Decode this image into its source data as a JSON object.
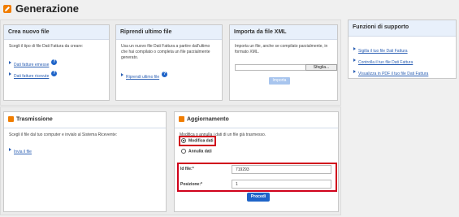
{
  "header": {
    "title": "Generazione"
  },
  "crea": {
    "title": "Crea nuovo file",
    "desc": "Scegli il tipo di file Dati Fattura da creare:",
    "links": [
      "Dati fatture emesse",
      "Dati fatture ricevute"
    ]
  },
  "riprendi": {
    "title": "Riprendi ultimo file",
    "desc": "Usa un nuovo file Dati Fattura a partire dall'ultimo che hai compilato o completa un file parzialmente generato.",
    "link": "Riprendi ultimo file"
  },
  "importa": {
    "title": "Importa da file XML",
    "desc": "Importa un file, anche se compilato parzialmente, in formato XML.",
    "browse": "Sfoglia...",
    "button": "Importa"
  },
  "supporto": {
    "title": "Funzioni di supporto",
    "links": [
      "Sigilla il tuo file Dati Fattura",
      "Controlla il tuo file Dati Fattura",
      "Visualizza in PDF il tuo file Dati Fattura"
    ]
  },
  "trasmissione": {
    "title": "Trasmissione",
    "desc": "Scegli il file dal tuo computer e invialo al Sistema Ricevente:",
    "link": "Invia il file"
  },
  "aggiornamento": {
    "title": "Aggiornamento",
    "desc": "Modifica o annulla i dati di un file già trasmesso.",
    "option_modifica": "Modifica dati",
    "option_annulla": "Annulla dati",
    "id_label": "Id file:*",
    "id_value": "719293",
    "pos_label": "Posizione:*",
    "pos_value": "1",
    "button": "Procedi"
  },
  "colors": {
    "accent": "#f07d00",
    "link": "#2b5fb3",
    "button": "#1f64c8",
    "highlight": "#d0021b"
  }
}
